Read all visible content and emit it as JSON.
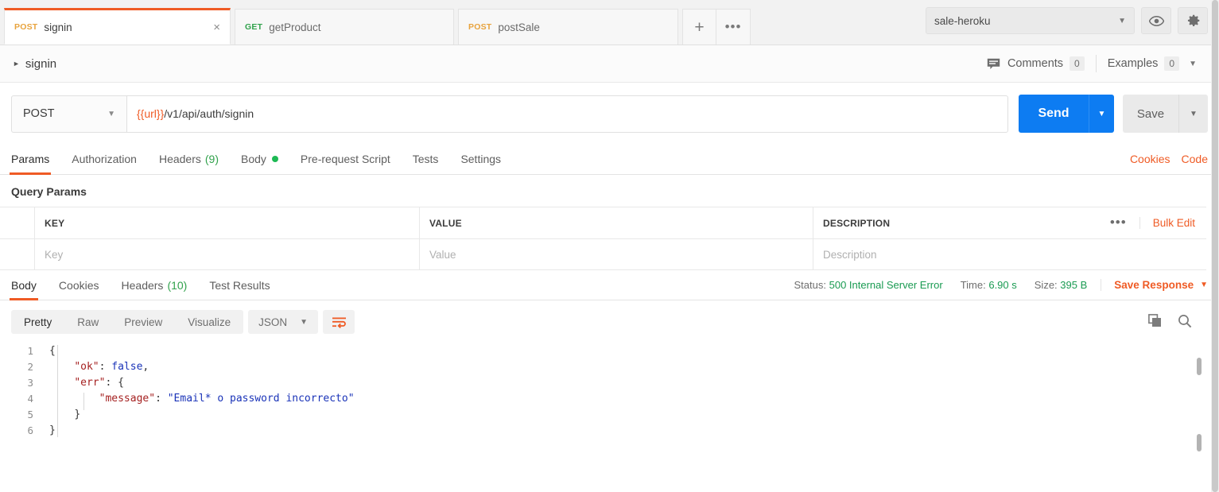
{
  "tabbar": {
    "tabs": [
      {
        "method": "POST",
        "name": "signin",
        "active": true,
        "close": "×"
      },
      {
        "method": "GET",
        "name": "getProduct",
        "active": false
      },
      {
        "method": "POST",
        "name": "postSale",
        "active": false
      }
    ],
    "new_tab_label": "+",
    "more_label": "•••",
    "environment": "sale-heroku",
    "eye_icon": "eye-icon",
    "gear_icon": "gear-icon"
  },
  "breadcrumb": {
    "label": "signin",
    "comments_label": "Comments",
    "comments_count": "0",
    "examples_label": "Examples",
    "examples_count": "0"
  },
  "request": {
    "method": "POST",
    "url_variable": "{{url}}",
    "url_path": "/v1/api/auth/signin",
    "send_label": "Send",
    "save_label": "Save"
  },
  "request_tabs": {
    "items": [
      {
        "label": "Params",
        "active": true
      },
      {
        "label": "Authorization",
        "active": false
      },
      {
        "label": "Headers",
        "count": "(9)",
        "active": false
      },
      {
        "label": "Body",
        "dot": true,
        "active": false
      },
      {
        "label": "Pre-request Script",
        "active": false
      },
      {
        "label": "Tests",
        "active": false
      },
      {
        "label": "Settings",
        "active": false
      }
    ],
    "cookies_label": "Cookies",
    "code_label": "Code"
  },
  "query_params": {
    "title": "Query Params",
    "columns": [
      "KEY",
      "VALUE",
      "DESCRIPTION"
    ],
    "bulk_edit_label": "Bulk Edit",
    "more_label": "•••",
    "row_placeholders": {
      "key": "Key",
      "value": "Value",
      "description": "Description"
    }
  },
  "response": {
    "tabs": [
      {
        "label": "Body",
        "active": true
      },
      {
        "label": "Cookies",
        "active": false
      },
      {
        "label": "Headers",
        "count": "(10)",
        "active": false
      },
      {
        "label": "Test Results",
        "active": false
      }
    ],
    "status_label": "Status:",
    "status_value": "500 Internal Server Error",
    "time_label": "Time:",
    "time_value": "6.90 s",
    "size_label": "Size:",
    "size_value": "395 B",
    "save_response_label": "Save Response",
    "view_modes": [
      {
        "label": "Pretty",
        "active": true
      },
      {
        "label": "Raw",
        "active": false
      },
      {
        "label": "Preview",
        "active": false
      },
      {
        "label": "Visualize",
        "active": false
      }
    ],
    "format": "JSON",
    "wrap_icon": "wrap-text-icon",
    "copy_icon": "copy-icon",
    "search_icon": "search-icon",
    "body_lines": [
      {
        "num": "1",
        "tokens": [
          {
            "t": "punc",
            "v": "{"
          }
        ]
      },
      {
        "num": "2",
        "tokens": [
          {
            "t": "plain",
            "v": "    "
          },
          {
            "t": "key",
            "v": "\"ok\""
          },
          {
            "t": "punc",
            "v": ": "
          },
          {
            "t": "bool",
            "v": "false"
          },
          {
            "t": "punc",
            "v": ","
          }
        ]
      },
      {
        "num": "3",
        "tokens": [
          {
            "t": "plain",
            "v": "    "
          },
          {
            "t": "key",
            "v": "\"err\""
          },
          {
            "t": "punc",
            "v": ": {"
          }
        ]
      },
      {
        "num": "4",
        "tokens": [
          {
            "t": "plain",
            "v": "        "
          },
          {
            "t": "key",
            "v": "\"message\""
          },
          {
            "t": "punc",
            "v": ": "
          },
          {
            "t": "str",
            "v": "\"Email* o password incorrecto\""
          }
        ]
      },
      {
        "num": "5",
        "tokens": [
          {
            "t": "plain",
            "v": "    "
          },
          {
            "t": "punc",
            "v": "}"
          }
        ]
      },
      {
        "num": "6",
        "tokens": [
          {
            "t": "punc",
            "v": "}"
          }
        ]
      }
    ]
  },
  "colors": {
    "accent_orange": "#ef5b25",
    "send_blue": "#0d7cf2",
    "status_green": "#1a9b52",
    "method_post": "#e8a33d",
    "method_get": "#31a24c"
  }
}
